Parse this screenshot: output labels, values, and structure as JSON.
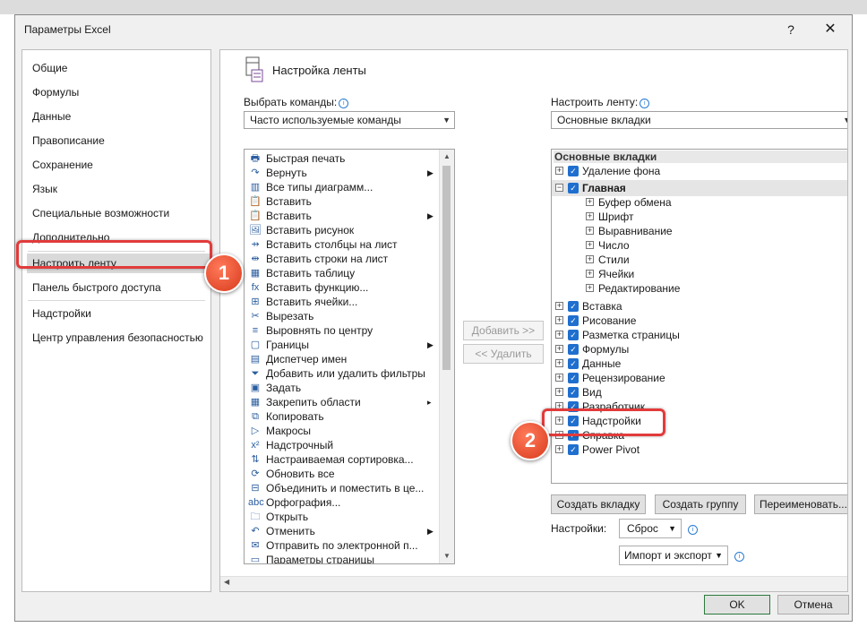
{
  "window": {
    "title": "Параметры Excel",
    "help": "?",
    "close": "✕"
  },
  "nav": [
    {
      "label": "Общие"
    },
    {
      "label": "Формулы"
    },
    {
      "label": "Данные"
    },
    {
      "label": "Правописание"
    },
    {
      "label": "Сохранение"
    },
    {
      "label": "Язык"
    },
    {
      "label": "Специальные возможности"
    },
    {
      "label": "Дополнительно"
    },
    {
      "label": "Настроить ленту",
      "selected": true
    },
    {
      "label": "Панель быстрого доступа"
    },
    {
      "label": "Надстройки"
    },
    {
      "label": "Центр управления безопасностью"
    }
  ],
  "panel": {
    "title": "Настройка ленты",
    "choose_label": "Выбрать команды:",
    "choose_value": "Часто используемые команды",
    "customize_label": "Настроить ленту:",
    "customize_value": "Основные вкладки",
    "add_button": "Добавить >>",
    "remove_button": "<< Удалить"
  },
  "commands": [
    {
      "label": "Быстрая печать",
      "icon": "🖶"
    },
    {
      "label": "Вернуть",
      "icon": "↷",
      "sub": "▶"
    },
    {
      "label": "Все типы диаграмм...",
      "icon": "▥"
    },
    {
      "label": "Вставить",
      "icon": "📋"
    },
    {
      "label": "Вставить",
      "icon": "📋",
      "sub": "▶"
    },
    {
      "label": "Вставить рисунок",
      "icon": "🖼"
    },
    {
      "label": "Вставить столбцы на лист",
      "icon": "⇸"
    },
    {
      "label": "Вставить строки на лист",
      "icon": "⇹"
    },
    {
      "label": "Вставить таблицу",
      "icon": "▦"
    },
    {
      "label": "Вставить функцию...",
      "icon": "fx"
    },
    {
      "label": "Вставить ячейки...",
      "icon": "⊞"
    },
    {
      "label": "Вырезать",
      "icon": "✂"
    },
    {
      "label": "Выровнять по центру",
      "icon": "≡"
    },
    {
      "label": "Границы",
      "icon": "▢",
      "sub": "▶"
    },
    {
      "label": "Диспетчер имен",
      "icon": "▤"
    },
    {
      "label": "Добавить или удалить фильтры",
      "icon": "⏷"
    },
    {
      "label": "Задать",
      "icon": "▣"
    },
    {
      "label": "Закрепить области",
      "icon": "▦",
      "sub": "▸"
    },
    {
      "label": "Копировать",
      "icon": "⧉"
    },
    {
      "label": "Макросы",
      "icon": "▷"
    },
    {
      "label": "Надстрочный",
      "icon": "x²"
    },
    {
      "label": "Настраиваемая сортировка...",
      "icon": "⇅"
    },
    {
      "label": "Обновить все",
      "icon": "⟳"
    },
    {
      "label": "Объединить и поместить в це...",
      "icon": "⊟"
    },
    {
      "label": "Орфография...",
      "icon": "abc"
    },
    {
      "label": "Открыть",
      "icon": "🗀"
    },
    {
      "label": "Отменить",
      "icon": "↶",
      "sub": "▶"
    },
    {
      "label": "Отправить по электронной п...",
      "icon": "✉"
    },
    {
      "label": "Параметры страницы",
      "icon": "▭"
    }
  ],
  "tree": {
    "header": "Основные вкладки",
    "items": [
      {
        "label": "Удаление фона",
        "level": 0,
        "expander": "+",
        "checked": true
      },
      {
        "label": "Главная",
        "level": 0,
        "expander": "−",
        "checked": true,
        "selected": true
      },
      {
        "label": "Буфер обмена",
        "level": 1,
        "expander": "+"
      },
      {
        "label": "Шрифт",
        "level": 1,
        "expander": "+"
      },
      {
        "label": "Выравнивание",
        "level": 1,
        "expander": "+"
      },
      {
        "label": "Число",
        "level": 1,
        "expander": "+"
      },
      {
        "label": "Стили",
        "level": 1,
        "expander": "+"
      },
      {
        "label": "Ячейки",
        "level": 1,
        "expander": "+"
      },
      {
        "label": "Редактирование",
        "level": 1,
        "expander": "+"
      },
      {
        "label": "Вставка",
        "level": 0,
        "expander": "+",
        "checked": true
      },
      {
        "label": "Рисование",
        "level": 0,
        "expander": "+",
        "checked": true
      },
      {
        "label": "Разметка страницы",
        "level": 0,
        "expander": "+",
        "checked": true
      },
      {
        "label": "Формулы",
        "level": 0,
        "expander": "+",
        "checked": true
      },
      {
        "label": "Данные",
        "level": 0,
        "expander": "+",
        "checked": true
      },
      {
        "label": "Рецензирование",
        "level": 0,
        "expander": "+",
        "checked": true
      },
      {
        "label": "Вид",
        "level": 0,
        "expander": "+",
        "checked": true
      },
      {
        "label": "Разработчик",
        "level": 0,
        "expander": "+",
        "checked": true
      },
      {
        "label": "Надстройки",
        "level": 0,
        "expander": "+",
        "checked": true
      },
      {
        "label": "Справка",
        "level": 0,
        "expander": "+",
        "checked": true
      },
      {
        "label": "Power Pivot",
        "level": 0,
        "expander": "+",
        "checked": true
      }
    ]
  },
  "buttons": {
    "new_tab": "Создать вкладку",
    "new_group": "Создать группу",
    "rename": "Переименовать...",
    "settings_label": "Настройки:",
    "reset": "Сброс",
    "import_export": "Импорт и экспорт",
    "ok": "OK",
    "cancel": "Отмена"
  },
  "annotations": {
    "step1": "1",
    "step2": "2",
    "accent": "#e23b3b"
  }
}
